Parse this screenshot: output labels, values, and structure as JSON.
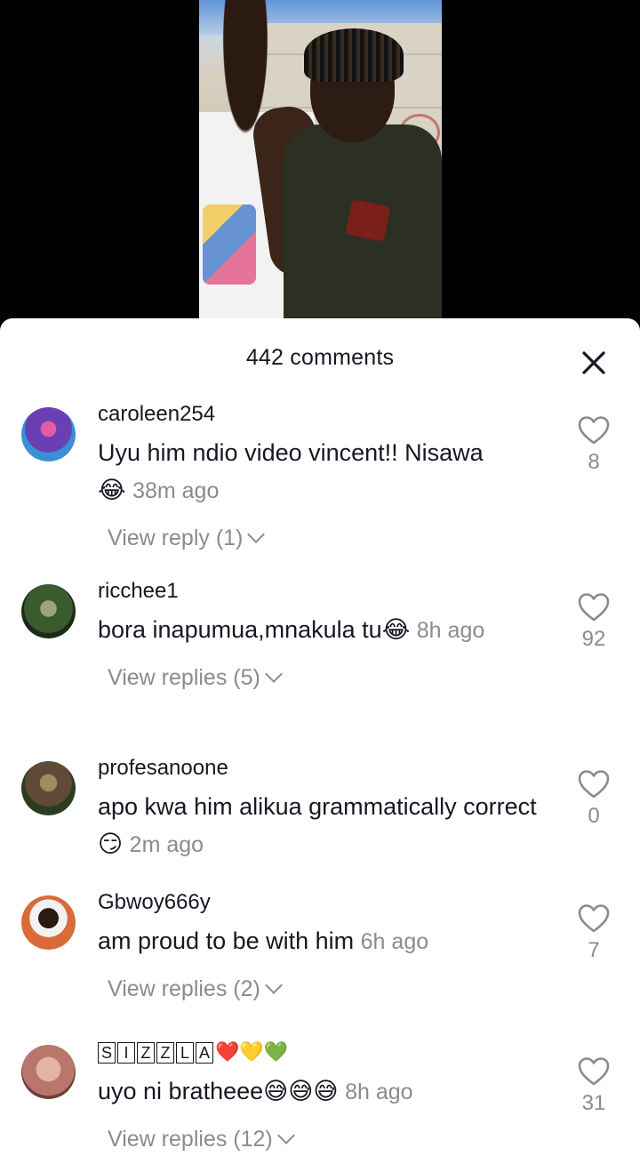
{
  "sheet": {
    "title": "442 comments"
  },
  "comments": [
    {
      "username": "caroleen254",
      "text": "Uyu him ndio video vincent!! Nisawa",
      "emoji": "😂",
      "time": "38m ago",
      "likes": "8",
      "view_replies": "View reply (1)",
      "avatar_colors": [
        "#6a3fb3",
        "#e85aa5",
        "#3a8fd6"
      ]
    },
    {
      "username": "ricchee1",
      "text": "bora inapumua,mnakula tu",
      "emoji": "😂",
      "time": "8h ago",
      "likes": "92",
      "view_replies": "View replies (5)",
      "avatar_colors": [
        "#3b5a2e",
        "#1d2a18",
        "#9ba77a"
      ]
    },
    {
      "username": "profesanoone",
      "text": "apo kwa him alikua grammatically correct",
      "emoji": "😏",
      "time": "2m ago",
      "likes": "0",
      "view_replies": "",
      "avatar_colors": [
        "#2c3b22",
        "#5e4a36",
        "#a08a5e"
      ]
    },
    {
      "username": "Gbwoy666y",
      "text": "am proud to be with him",
      "emoji": "",
      "time": "6h ago",
      "likes": "7",
      "view_replies": "View replies (2)",
      "avatar_colors": [
        "#d96b3a",
        "#2a1a12",
        "#f2f2f2"
      ]
    },
    {
      "username_letters": [
        "S",
        "I",
        "Z",
        "Z",
        "L",
        "A"
      ],
      "username_emoji": "❤️💛💚",
      "text": "uyo ni bratheee",
      "emoji": "😅😅😅",
      "time": "8h ago",
      "likes": "31",
      "view_replies": "View replies (12)",
      "avatar_colors": [
        "#b8776a",
        "#e2b3a6",
        "#6d3f36"
      ]
    }
  ],
  "icons": {
    "close": "close-icon",
    "like": "heart-outline-icon",
    "chevron": "chevron-down-icon"
  },
  "colors": {
    "text_primary": "#161823",
    "text_secondary": "#8a8b91",
    "sheet_bg": "#ffffff",
    "backdrop": "#000000"
  }
}
